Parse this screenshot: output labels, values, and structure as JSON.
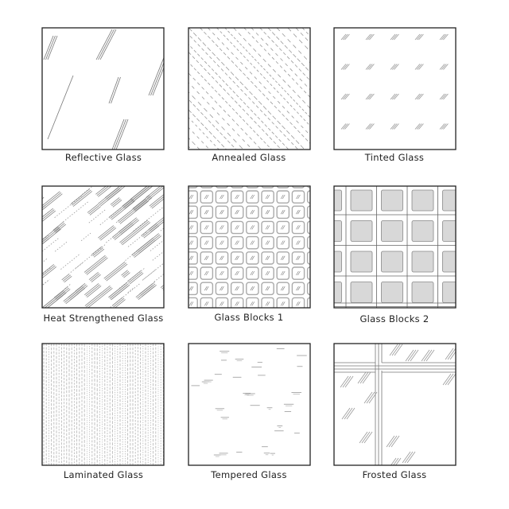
{
  "panels": [
    {
      "label": "Reflective Glass",
      "pattern": "reflective"
    },
    {
      "label": "Annealed Glass",
      "pattern": "annealed"
    },
    {
      "label": "Tinted Glass",
      "pattern": "tinted"
    },
    {
      "label": "Heat Strengthened Glass",
      "pattern": "heat"
    },
    {
      "label": "Glass Blocks 1",
      "pattern": "blocks1"
    },
    {
      "label": "Glass Blocks 2",
      "pattern": "blocks2"
    },
    {
      "label": "Laminated Glass",
      "pattern": "laminated"
    },
    {
      "label": "Tempered Glass",
      "pattern": "tempered"
    },
    {
      "label": "Frosted Glass",
      "pattern": "frosted"
    }
  ],
  "colors": {
    "border": "#222222",
    "hatch": "#999999",
    "fill": "#d8d8d8"
  }
}
